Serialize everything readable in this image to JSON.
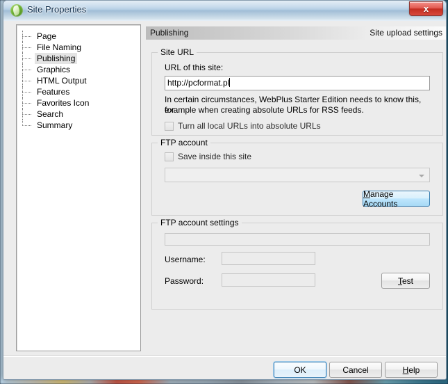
{
  "window": {
    "title": "Site Properties",
    "icon": "webplus-logo-icon",
    "close_label": "x"
  },
  "sidebar": {
    "items": [
      {
        "label": "Page",
        "selected": false
      },
      {
        "label": "File Naming",
        "selected": false
      },
      {
        "label": "Publishing",
        "selected": true
      },
      {
        "label": "Graphics",
        "selected": false
      },
      {
        "label": "HTML Output",
        "selected": false
      },
      {
        "label": "Features",
        "selected": false
      },
      {
        "label": "Favorites Icon",
        "selected": false
      },
      {
        "label": "Search",
        "selected": false
      },
      {
        "label": "Summary",
        "selected": false
      }
    ]
  },
  "section_header": {
    "left": "Publishing",
    "right": "Site upload settings"
  },
  "site_url": {
    "group_title": "Site URL",
    "url_label": "URL of this site:",
    "url_value": "http://pcformat.pl",
    "url_placeholder": "",
    "help_line1": "In certain circumstances, WebPlus Starter Edition needs to know this, for",
    "help_line2": "example when creating absolute URLs for RSS feeds.",
    "absolute_checkbox_label": "Turn all local URLs into absolute URLs",
    "absolute_checkbox_checked": false
  },
  "ftp_account": {
    "group_title": "FTP account",
    "save_checkbox_label": "Save inside this site",
    "save_checkbox_checked": false,
    "account_combo_value": "",
    "manage_button_label": "Manage Accounts",
    "manage_button_mnemonic": "M"
  },
  "ftp_settings": {
    "group_title": "FTP account settings",
    "server_value": "",
    "username_label": "Username:",
    "username_value": "",
    "password_label": "Password:",
    "password_value": "",
    "test_button_label": "Test",
    "test_button_mnemonic": "T"
  },
  "footer": {
    "ok_label": "OK",
    "cancel_label": "Cancel",
    "help_label": "Help",
    "help_mnemonic": "H"
  },
  "colors": {
    "dialog_background": "#ececec",
    "titlebar_blue": "#b4cfe6",
    "close_red": "#c32e22",
    "accent_blue": "#3c7fb1",
    "header_gradient_start": "#bcbcbc",
    "header_gradient_end": "#fbfbfb"
  }
}
